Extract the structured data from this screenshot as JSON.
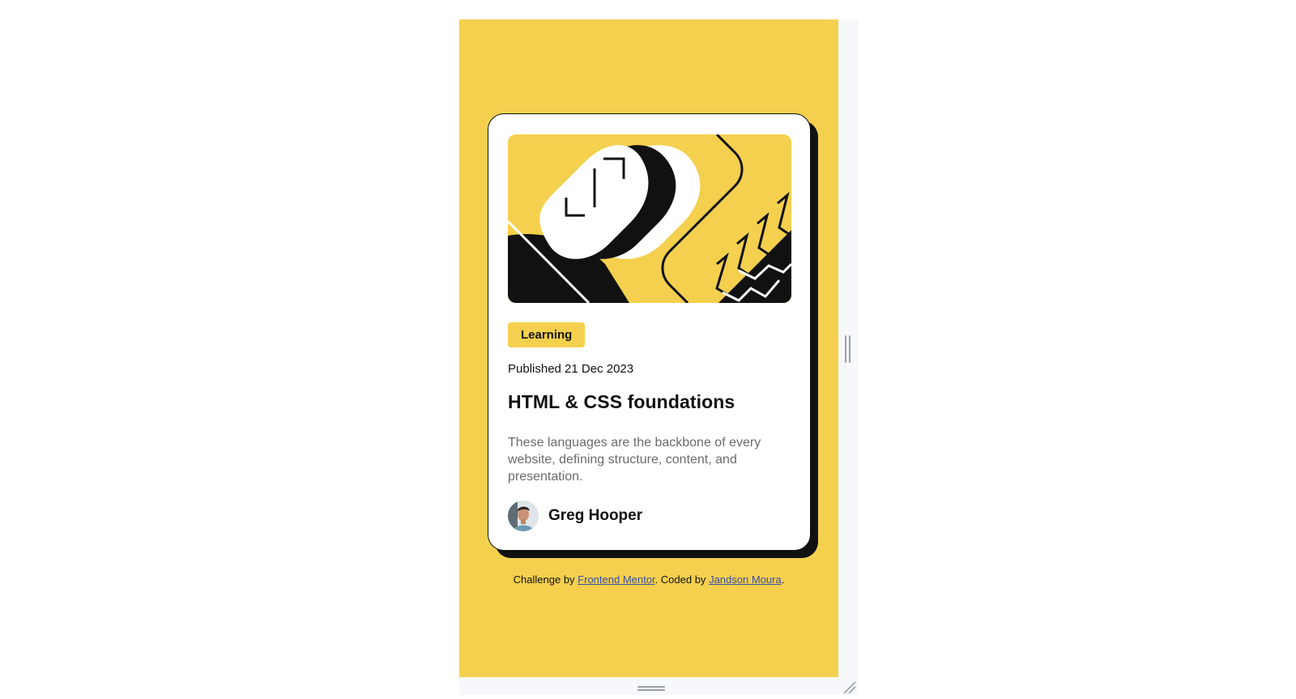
{
  "card": {
    "tag": "Learning",
    "published": "Published 21 Dec 2023",
    "title": "HTML & CSS foundations",
    "description": "These languages are the backbone of every website, defining structure, content, and presentation.",
    "author": "Greg Hooper"
  },
  "attribution": {
    "prefix": "Challenge by ",
    "link1": "Frontend Mentor",
    "middle": ". Coded by ",
    "link2": "Jandson Moura",
    "suffix": "."
  },
  "colors": {
    "page_bg": "#f4d04e",
    "card_bg": "#ffffff",
    "ink": "#111111",
    "muted_text": "#6b6b6b",
    "link": "#3b4da5"
  },
  "icons": {
    "resize_handle_side": "vertical-grip-icon",
    "resize_handle_bottom": "horizontal-grip-icon",
    "resize_corner": "resize-corner-icon"
  }
}
